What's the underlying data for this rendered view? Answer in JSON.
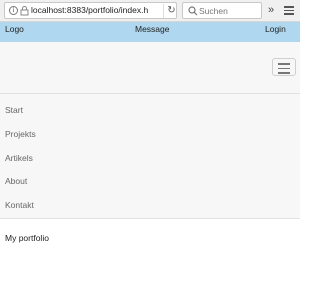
{
  "browser": {
    "url": "localhost:8383/portfolio/index.h",
    "search_placeholder": "Suchen",
    "overflow_label": "»"
  },
  "header": {
    "logo": "Logo",
    "message": "Message",
    "login": "Login"
  },
  "nav": {
    "items": [
      {
        "label": "Start"
      },
      {
        "label": "Projekts"
      },
      {
        "label": "Artikels"
      },
      {
        "label": "About"
      },
      {
        "label": "Kontakt"
      }
    ]
  },
  "main": {
    "title": "My portfolio"
  }
}
